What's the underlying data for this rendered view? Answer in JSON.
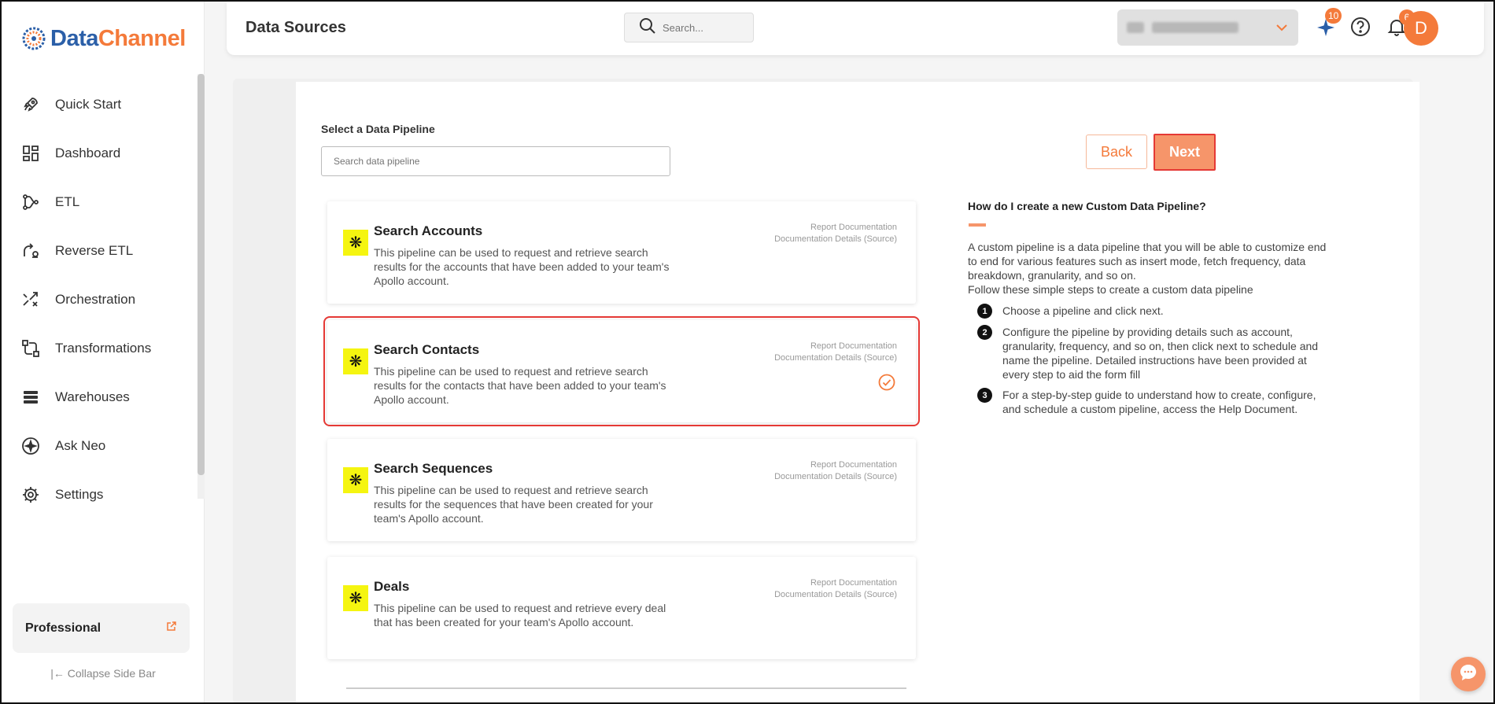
{
  "brand": {
    "name_part1": "Data",
    "name_part2": "Channel"
  },
  "sidebar": {
    "items": [
      {
        "label": "Quick Start",
        "icon": "rocket-icon"
      },
      {
        "label": "Dashboard",
        "icon": "dashboard-icon"
      },
      {
        "label": "ETL",
        "icon": "etl-icon"
      },
      {
        "label": "Reverse ETL",
        "icon": "reverse-etl-icon"
      },
      {
        "label": "Orchestration",
        "icon": "orchestration-icon"
      },
      {
        "label": "Transformations",
        "icon": "transformations-icon"
      },
      {
        "label": "Warehouses",
        "icon": "warehouses-icon"
      },
      {
        "label": "Ask Neo",
        "icon": "ask-neo-icon"
      },
      {
        "label": "Settings",
        "icon": "gear-icon"
      }
    ],
    "plan": "Professional",
    "collapse_label": "Collapse Side Bar"
  },
  "header": {
    "title": "Data Sources",
    "search_placeholder": "Search...",
    "neo_badge": "10",
    "notifications_badge": "6",
    "avatar_initial": "D"
  },
  "main": {
    "select_label": "Select a Data Pipeline",
    "search_placeholder": "Search data pipeline",
    "back_label": "Back",
    "next_label": "Next",
    "pipelines": [
      {
        "title": "Search Accounts",
        "description": "This pipeline can be used to request and retrieve search results for the accounts that have been added to your team's Apollo account.",
        "link1": "Report Documentation",
        "link2": "Documentation Details (Source)",
        "selected": false
      },
      {
        "title": "Search Contacts",
        "description": "This pipeline can be used to request and retrieve search results for the contacts that have been added to your team's Apollo account.",
        "link1": "Report Documentation",
        "link2": "Documentation Details (Source)",
        "selected": true
      },
      {
        "title": "Search Sequences",
        "description": "This pipeline can be used to request and retrieve search results for the sequences that have been created for your team's Apollo account.",
        "link1": "Report Documentation",
        "link2": "Documentation Details (Source)",
        "selected": false
      },
      {
        "title": "Deals",
        "description": "This pipeline can be used to request and retrieve every deal that has been created for your team's Apollo account.",
        "link1": "Report Documentation",
        "link2": "Documentation Details (Source)",
        "selected": false
      }
    ]
  },
  "help": {
    "title": "How do I create a new Custom Data Pipeline?",
    "intro": "A custom pipeline is a data pipeline that you will be able to customize end to end for various features such as insert mode, fetch frequency, data breakdown, granularity, and so on.",
    "intro2": "Follow these simple steps to create a custom data pipeline",
    "steps": [
      {
        "num": "1",
        "text": "Choose a pipeline and click next."
      },
      {
        "num": "2",
        "text": "Configure the pipeline by providing details such as account, granularity, frequency, and so on, then click next to schedule and name the pipeline. Detailed instructions have been provided at every step to aid the form fill"
      },
      {
        "num": "3",
        "text": "For a step-by-step guide to understand how to create, configure, and schedule a custom pipeline, access the Help Document."
      }
    ]
  },
  "colors": {
    "accent": "#f47a3a",
    "brand_blue": "#2b5fa8",
    "selected_outline": "#e53935",
    "pipeline_icon_bg": "#f5f510"
  }
}
